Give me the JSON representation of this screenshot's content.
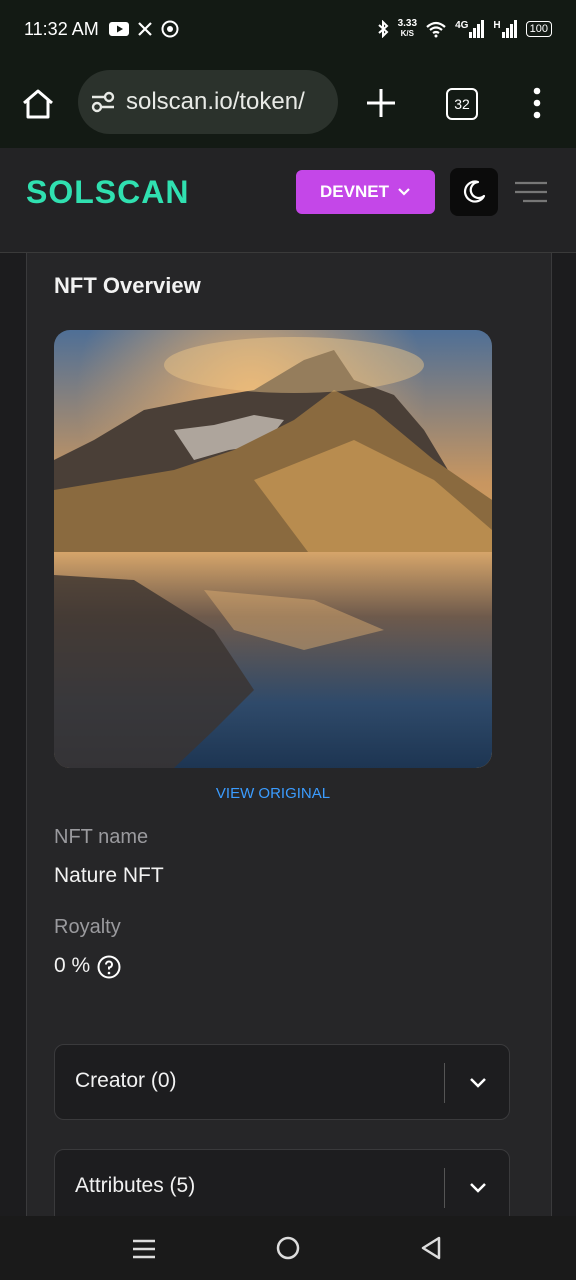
{
  "status": {
    "time": "11:32 AM",
    "speed_value": "3.33",
    "speed_unit": "K/S",
    "net_1": "4G",
    "net_2": "H",
    "battery": "100",
    "left_icons": [
      "youtube-icon",
      "x-icon",
      "aperture-icon"
    ],
    "right_icons": [
      "bluetooth-icon",
      "wifi-icon",
      "signal-icon",
      "signal-icon"
    ]
  },
  "browser": {
    "url": "solscan.io/token/",
    "tab_count": "32",
    "icons": [
      "home-icon",
      "site-settings-icon",
      "plus-icon",
      "more-vert-icon"
    ]
  },
  "site": {
    "logo": "SOLSCAN",
    "network_label": "DEVNET",
    "accent": "#c447e8",
    "logo_color": "#30e0b0"
  },
  "nft": {
    "section_title": "NFT Overview",
    "view_original": "VIEW ORIGINAL",
    "name_label": "NFT name",
    "name_value": "Nature NFT",
    "royalty_label": "Royalty",
    "royalty_value": "0 %",
    "link_color": "#3b9cff"
  },
  "accordions": [
    {
      "label": "Creator (0)"
    },
    {
      "label": "Attributes (5)"
    }
  ],
  "navbar": {
    "icons": [
      "recent-apps-icon",
      "home-circle-icon",
      "back-icon"
    ]
  }
}
